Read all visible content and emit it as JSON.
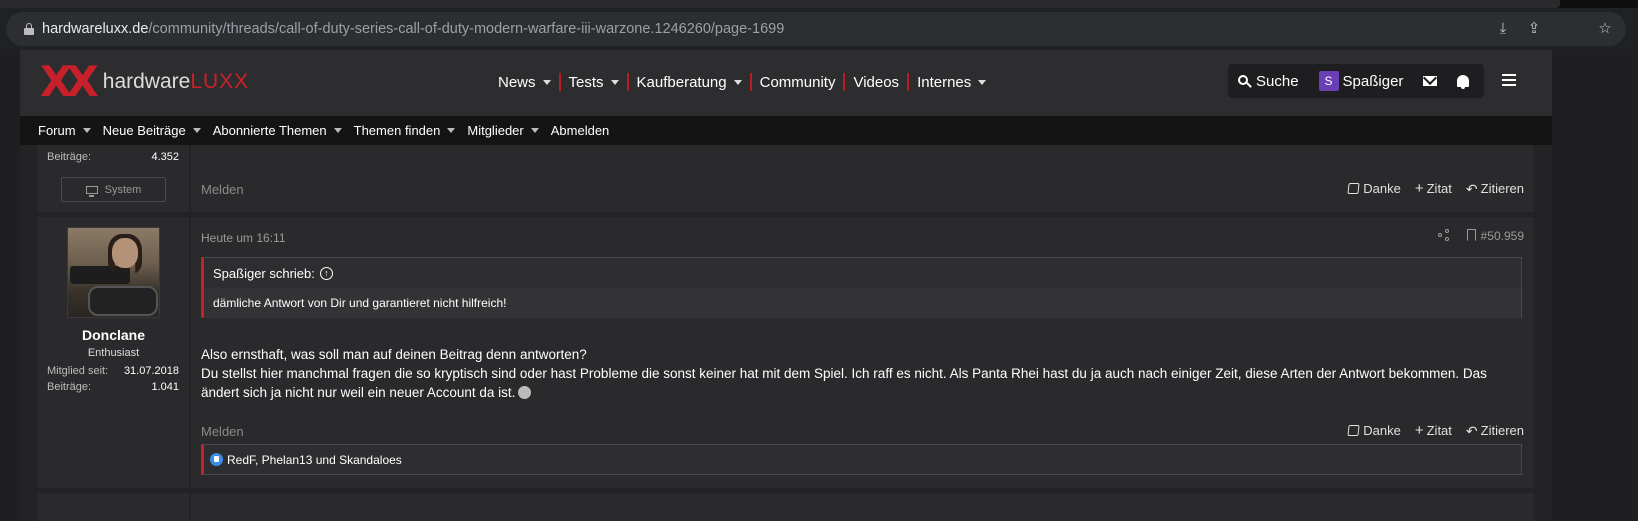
{
  "browser": {
    "url_host": "hardwareluxx.de",
    "url_path": "/community/threads/call-of-duty-series-call-of-duty-modern-warfare-iii-warzone.1246260/page-1699"
  },
  "site": {
    "logo_brand": "hardware",
    "logo_accent": "LUXX",
    "main_nav": [
      {
        "label": "News",
        "dropdown": true
      },
      {
        "label": "Tests",
        "dropdown": true
      },
      {
        "label": "Kaufberatung",
        "dropdown": true
      },
      {
        "label": "Community",
        "dropdown": false
      },
      {
        "label": "Videos",
        "dropdown": false
      },
      {
        "label": "Internes",
        "dropdown": true
      }
    ],
    "search_label": "Suche",
    "user_initial": "S",
    "user_name": "Spaßiger",
    "accent_color": "#c8202a",
    "sub_nav": [
      {
        "label": "Forum",
        "dropdown": true
      },
      {
        "label": "Neue Beiträge",
        "dropdown": true
      },
      {
        "label": "Abonnierte Themen",
        "dropdown": true
      },
      {
        "label": "Themen finden",
        "dropdown": true
      },
      {
        "label": "Mitglieder",
        "dropdown": true
      },
      {
        "label": "Abmelden",
        "dropdown": false
      }
    ]
  },
  "post1": {
    "stats_label": "Beiträge:",
    "stats_value": "4.352",
    "system_button": "System",
    "report": "Melden",
    "actions": {
      "like": "Danke",
      "quote": "Zitat",
      "reply": "Zitieren"
    }
  },
  "post2": {
    "author": "Donclane",
    "user_title": "Enthusiast",
    "member_since_label": "Mitglied seit:",
    "member_since_value": "31.07.2018",
    "posts_label": "Beiträge:",
    "posts_value": "1.041",
    "date": "Heute um 16:11",
    "post_number": "#50.959",
    "quote_author": "Spaßiger schrieb:",
    "quote_text": "dämliche Antwort von Dir und garantieret nicht hilfreich!",
    "body_line1": "Also ernsthaft, was soll man auf deinen Beitrag denn antworten?",
    "body_line2": "Du stellst hier manchmal fragen die so kryptisch sind oder hast Probleme die sonst keiner hat mit dem Spiel. Ich raff es nicht. Als Panta Rhei hast du ja auch nach einiger Zeit, diese Arten der Antwort bekommen. Das ändert sich ja nicht nur weil ein neuer Account da ist.",
    "report": "Melden",
    "actions": {
      "like": "Danke",
      "quote": "Zitat",
      "reply": "Zitieren"
    },
    "reactions_text": "RedF, Phelan13 und Skandaloes"
  }
}
